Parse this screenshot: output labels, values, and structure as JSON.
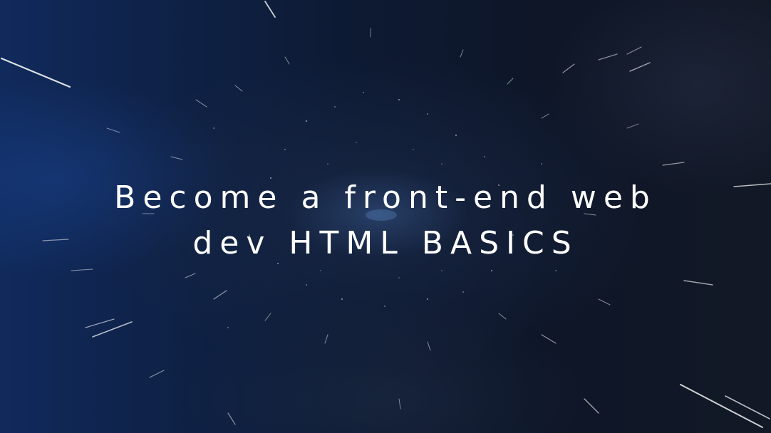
{
  "slide": {
    "title_line1": "Become a front-end web",
    "title_line2": "dev HTML BASICS"
  },
  "colors": {
    "background": "#0d1a33",
    "accent_blue": "#102a5c",
    "title_text": "#ffffff",
    "streaks": "#ffffff"
  }
}
